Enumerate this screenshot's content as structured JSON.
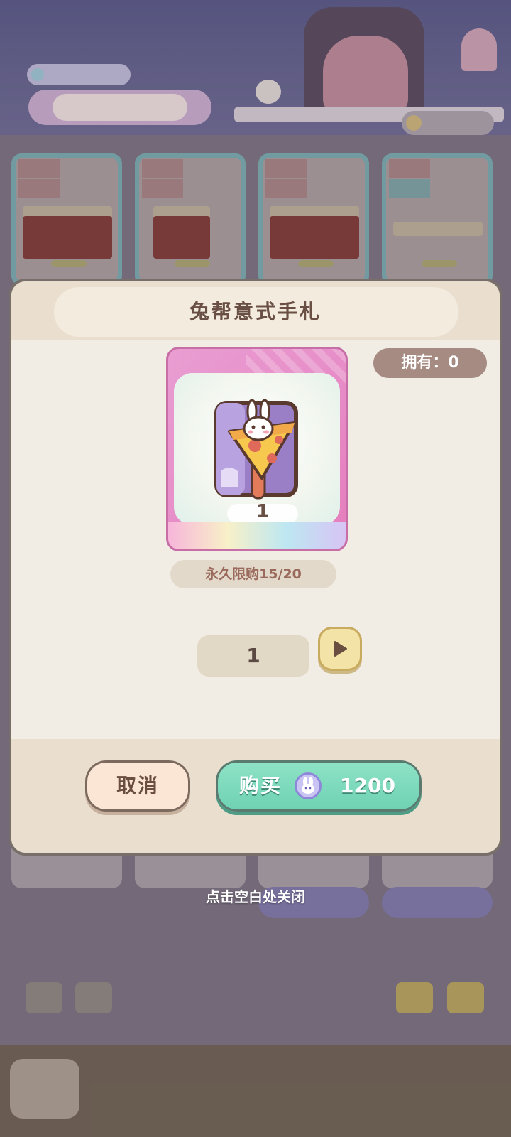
{
  "modal": {
    "title": "兔帮意式手札",
    "owned_label": "拥有：0",
    "item_quantity": "1",
    "purchase_limit": "永久限购15/20",
    "selected_quantity": "1",
    "cancel_label": "取消",
    "buy_label": "购买",
    "price": "1200"
  },
  "close_hint": "点击空白处关闭",
  "colors": {
    "buy_button": "#7ad9bb",
    "cancel_button": "#fbe6d6",
    "card_frame": "#e57dbd",
    "title_text": "#6a4f44"
  },
  "icons": {
    "item": "rabbit-pizza-notebook-icon",
    "currency": "rabbit-coin-icon",
    "next": "play-arrow-icon"
  }
}
